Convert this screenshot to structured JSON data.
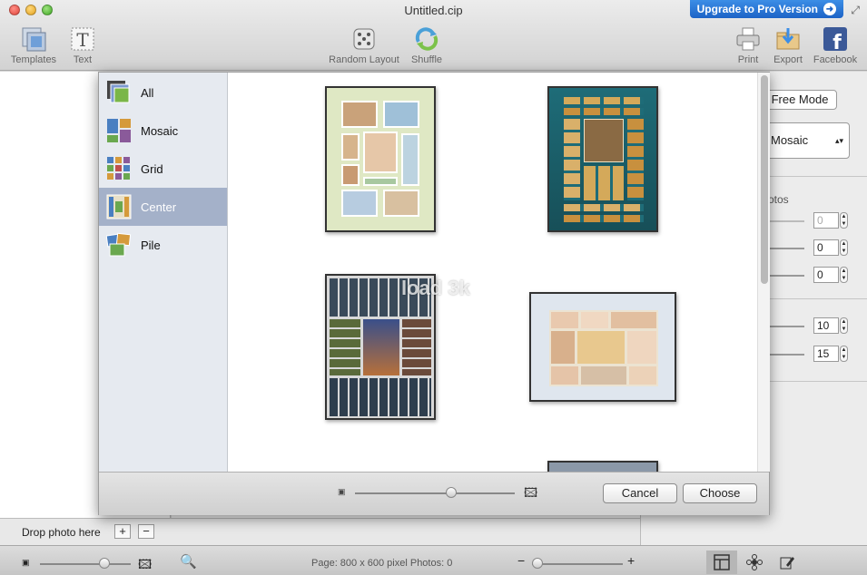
{
  "window": {
    "title": "Untitled.cip",
    "upgrade_label": "Upgrade to Pro Version"
  },
  "toolbar": {
    "templates": "Templates",
    "text": "Text",
    "random_layout": "Random Layout",
    "shuffle": "Shuffle",
    "print": "Print",
    "export": "Export",
    "facebook": "Facebook"
  },
  "right_panel": {
    "free_mode": "Free Mode",
    "mode_select": "Mosaic",
    "photos_label": "otos",
    "values": [
      "0",
      "0",
      "0",
      "10",
      "15"
    ]
  },
  "popup": {
    "categories": [
      {
        "label": "All",
        "icon": "all-icon"
      },
      {
        "label": "Mosaic",
        "icon": "mosaic-icon"
      },
      {
        "label": "Grid",
        "icon": "grid-icon"
      },
      {
        "label": "Center",
        "icon": "center-icon"
      },
      {
        "label": "Pile",
        "icon": "pile-icon"
      }
    ],
    "selected_category": "Center",
    "cancel": "Cancel",
    "choose": "Choose",
    "watermark": "load 3k"
  },
  "left": {
    "drop_label": "Drop photo here",
    "add": "+",
    "remove": "−"
  },
  "status": {
    "text": "Page: 800 x 600 pixel Photos: 0",
    "minus": "−",
    "plus": "+"
  },
  "colors": {
    "accent": "#1c63c6",
    "selection": "#a4b1c9",
    "sidebar": "#e6eaf0"
  }
}
